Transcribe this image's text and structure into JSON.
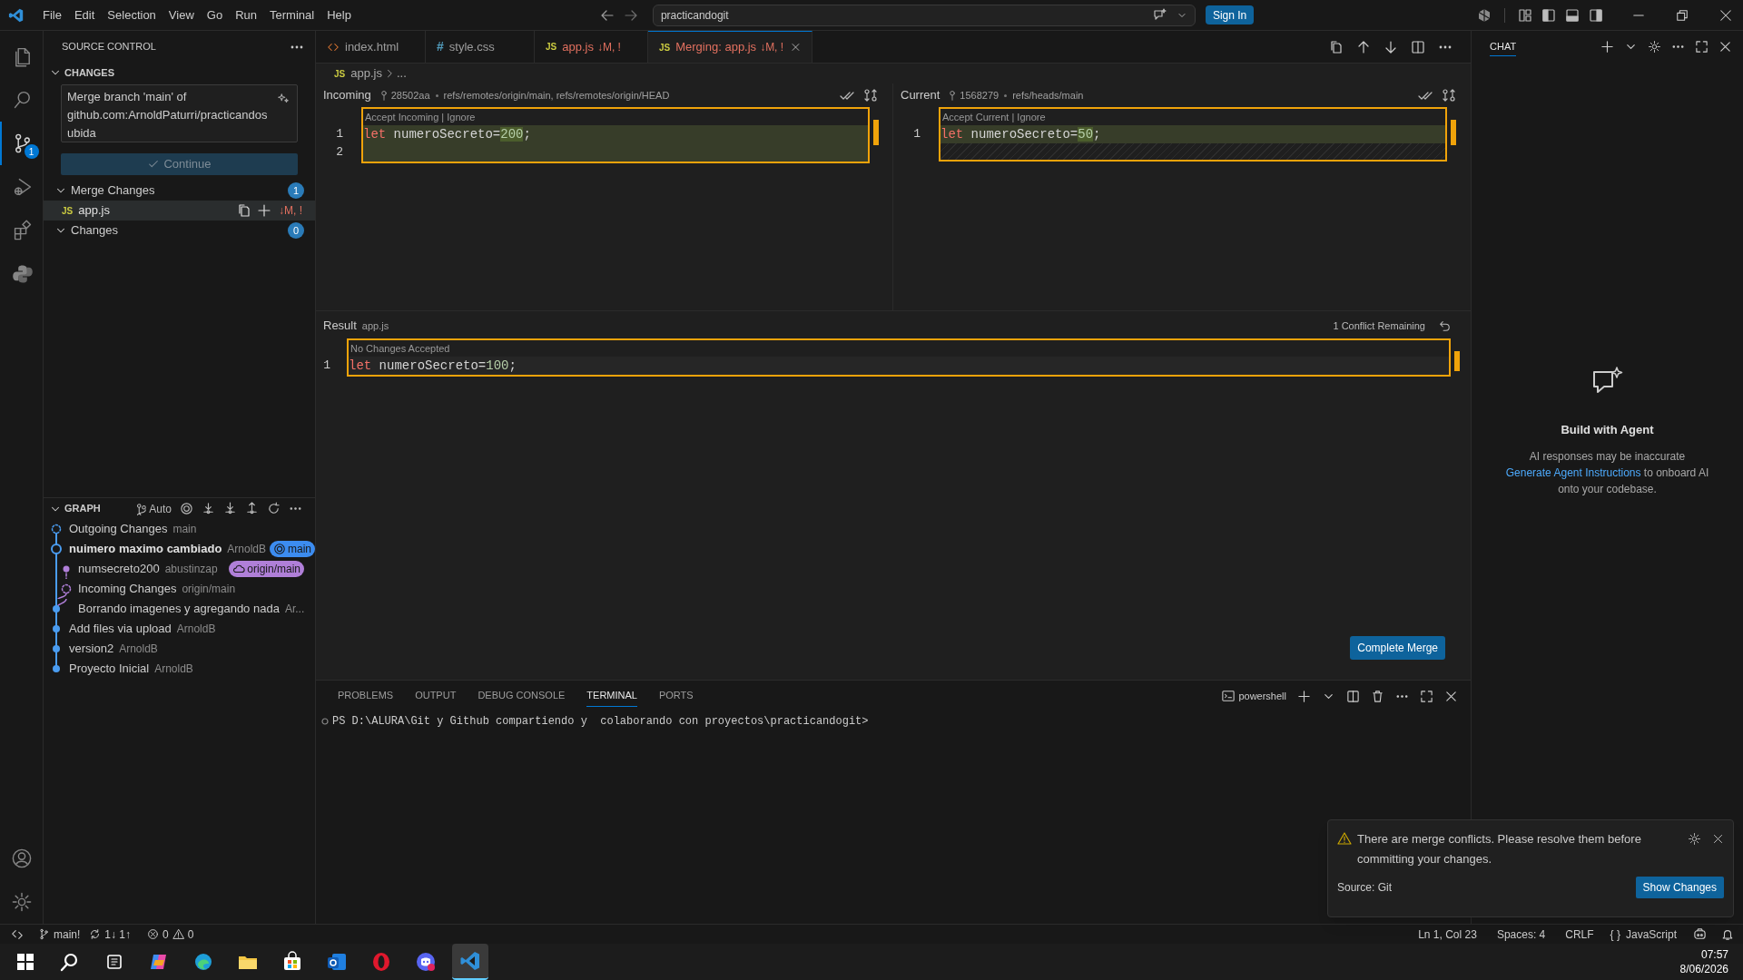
{
  "title_bar": {
    "menu": [
      "File",
      "Edit",
      "Selection",
      "View",
      "Go",
      "Run",
      "Terminal",
      "Help"
    ],
    "command_center": "practicandogit",
    "sign_in": "Sign In"
  },
  "activity_bar": [
    {
      "kind": "files",
      "selected": false
    },
    {
      "kind": "search",
      "selected": false
    },
    {
      "kind": "source-control",
      "selected": true,
      "badge": "1"
    },
    {
      "kind": "debug",
      "selected": false
    },
    {
      "kind": "extensions",
      "selected": false
    },
    {
      "kind": "python",
      "selected": false
    }
  ],
  "sidebar": {
    "title": "SOURCE CONTROL",
    "section": "CHANGES",
    "commit_message": "Merge branch 'main' of github.com:ArnoldPaturri/practicandosubida",
    "continue_button": "Continue",
    "groups": [
      {
        "label": "Merge Changes",
        "count": "1",
        "expanded": true,
        "files": [
          {
            "glyph": "JS",
            "name": "app.js",
            "status": "↓M, !",
            "selected": true
          }
        ]
      },
      {
        "label": "Changes",
        "count": "0",
        "expanded": true
      }
    ],
    "graph": {
      "title": "GRAPH",
      "expanded": true,
      "auto_label": "Auto",
      "commits": [
        {
          "kind": "outgoing",
          "message": "Outgoing Changes",
          "author": "main"
        },
        {
          "kind": "head",
          "message": "nuimero maximo cambiado",
          "author": "ArnoldB",
          "ref": {
            "kind": "local",
            "label": "main",
            "color": "#3c8cf0"
          }
        },
        {
          "kind": "incoming-commit",
          "message": "numsecreto200",
          "author": "abustinzap",
          "ref": {
            "kind": "remote",
            "label": "origin/main",
            "color": "#b07fd8"
          }
        },
        {
          "kind": "incoming",
          "message": "Incoming Changes",
          "author": "origin/main"
        },
        {
          "kind": "merge-base",
          "message": "Borrando imagenes y agregando nada",
          "author": "Ar..."
        },
        {
          "kind": "commit",
          "message": "Add files via upload",
          "author": "ArnoldB"
        },
        {
          "kind": "commit",
          "message": "version2",
          "author": "ArnoldB"
        },
        {
          "kind": "commit",
          "message": "Proyecto Inicial",
          "author": "ArnoldB"
        }
      ]
    }
  },
  "editor_tabs": [
    {
      "kind": "html",
      "label": "index.html",
      "selected": false
    },
    {
      "kind": "css",
      "glyph": "#",
      "label": "style.css",
      "selected": false
    },
    {
      "kind": "js",
      "glyph": "JS",
      "label": "app.js",
      "status": "↓M, !",
      "selected": false
    },
    {
      "kind": "js",
      "glyph": "JS",
      "label": "Merging: app.js",
      "status": "↓M, !",
      "selected": true
    }
  ],
  "breadcrumb": {
    "glyph": "JS",
    "file": "app.js",
    "rest": "..."
  },
  "panes": [
    {
      "title": "Incoming",
      "commit": "28502aa",
      "refs": "refs/remotes/origin/main, refs/remotes/origin/HEAD",
      "codelens": "Accept Incoming | Ignore",
      "lines": [
        {
          "number": "1",
          "tokens": [
            {
              "kind": "keyword",
              "text": "let"
            },
            {
              "kind": "plain",
              "text": " numeroSecreto="
            },
            {
              "kind": "number",
              "text": "200"
            },
            {
              "kind": "plain",
              "text": ";"
            }
          ]
        },
        {
          "number": "2"
        }
      ]
    },
    {
      "title": "Current",
      "commit": "1568279",
      "refs": "refs/heads/main",
      "codelens": "Accept Current | Ignore",
      "lines": [
        {
          "number": "1",
          "tokens": [
            {
              "kind": "keyword",
              "text": "let"
            },
            {
              "kind": "plain",
              "text": " numeroSecreto="
            },
            {
              "kind": "number",
              "text": "50"
            },
            {
              "kind": "plain",
              "text": ";"
            }
          ]
        }
      ]
    }
  ],
  "result": {
    "title": "Result",
    "file": "app.js",
    "conflicts": "1 Conflict Remaining",
    "codelens": "No Changes Accepted",
    "lines": [
      {
        "number": "1",
        "tokens": [
          {
            "kind": "keyword",
            "text": "let"
          },
          {
            "kind": "plain",
            "text": " numeroSecreto="
          },
          {
            "kind": "plain-number",
            "text": "100"
          },
          {
            "kind": "plain",
            "text": ";"
          }
        ]
      }
    ],
    "complete_button": "Complete Merge"
  },
  "panel": {
    "tabs": [
      {
        "label": "PROBLEMS",
        "selected": false
      },
      {
        "label": "OUTPUT",
        "selected": false
      },
      {
        "label": "DEBUG CONSOLE",
        "selected": false
      },
      {
        "label": "TERMINAL",
        "selected": true
      },
      {
        "label": "PORTS",
        "selected": false
      }
    ],
    "shell": "powershell",
    "terminal_line": "PS D:\\ALURA\\Git y Github compartiendo y  colaborando con proyectos\\practicandogit>"
  },
  "chat": {
    "title": "CHAT",
    "heading": "Build with Agent",
    "text_before": "AI responses may be inaccurate",
    "link": "Generate Agent Instructions",
    "text_after": "to onboard AI onto your codebase."
  },
  "notification": {
    "message": "There are merge conflicts. Please resolve them before committing your changes.",
    "source": "Source: Git",
    "button": "Show Changes"
  },
  "status_bar": {
    "branch": "main!",
    "sync": "1↓ 1↑",
    "errors": "0",
    "warnings": "0",
    "position": "Ln 1, Col 23",
    "spaces": "Spaces: 4",
    "eol": "CRLF",
    "language_glyph": "{ }",
    "language": "JavaScript"
  },
  "taskbar": {
    "apps": [
      {
        "kind": "start",
        "active": false
      },
      {
        "kind": "search",
        "active": false
      },
      {
        "kind": "task-view",
        "active": false
      },
      {
        "kind": "copilot",
        "active": false
      },
      {
        "kind": "edge",
        "active": false
      },
      {
        "kind": "folder",
        "active": false
      },
      {
        "kind": "store",
        "active": false
      },
      {
        "kind": "mail",
        "active": false
      },
      {
        "kind": "opera",
        "active": false
      },
      {
        "kind": "discord",
        "active": false
      },
      {
        "kind": "vscode",
        "active": true
      }
    ],
    "time": "07:57",
    "date": "8/06/2026"
  }
}
